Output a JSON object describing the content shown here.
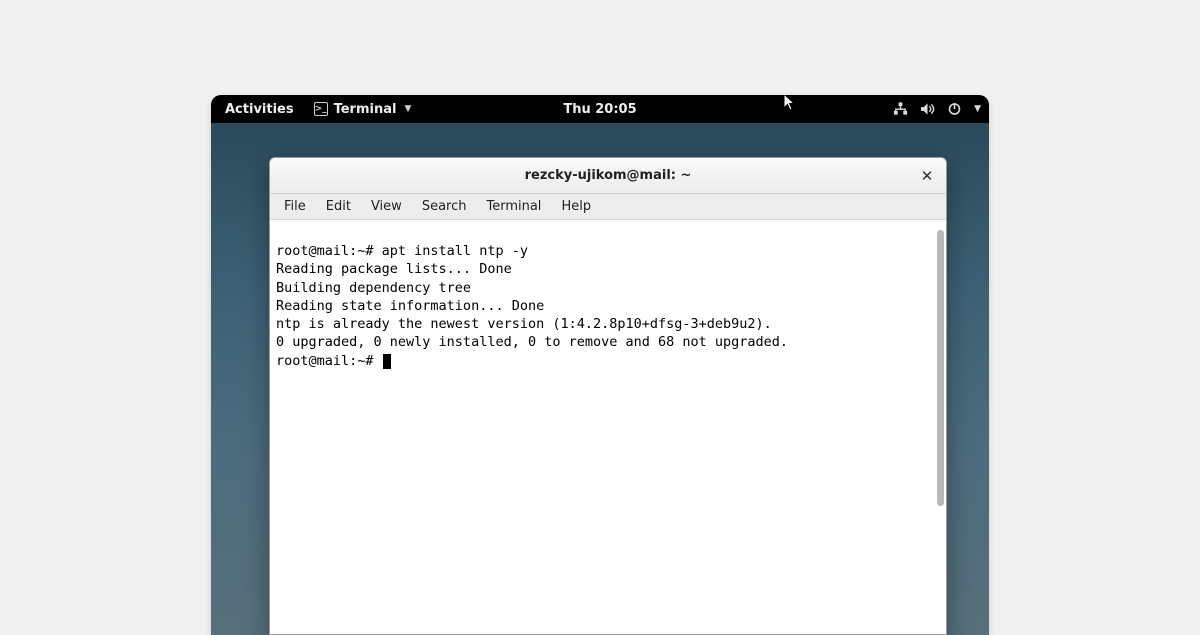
{
  "topbar": {
    "activities": "Activities",
    "app_name": "Terminal",
    "clock": "Thu 20:05"
  },
  "window": {
    "title": "rezcky-ujikom@mail: ~",
    "menu": {
      "file": "File",
      "edit": "Edit",
      "view": "View",
      "search": "Search",
      "terminal": "Terminal",
      "help": "Help"
    }
  },
  "terminal": {
    "lines": [
      "root@mail:~# apt install ntp -y",
      "Reading package lists... Done",
      "Building dependency tree",
      "Reading state information... Done",
      "ntp is already the newest version (1:4.2.8p10+dfsg-3+deb9u2).",
      "0 upgraded, 0 newly installed, 0 to remove and 68 not upgraded.",
      "root@mail:~# "
    ]
  }
}
